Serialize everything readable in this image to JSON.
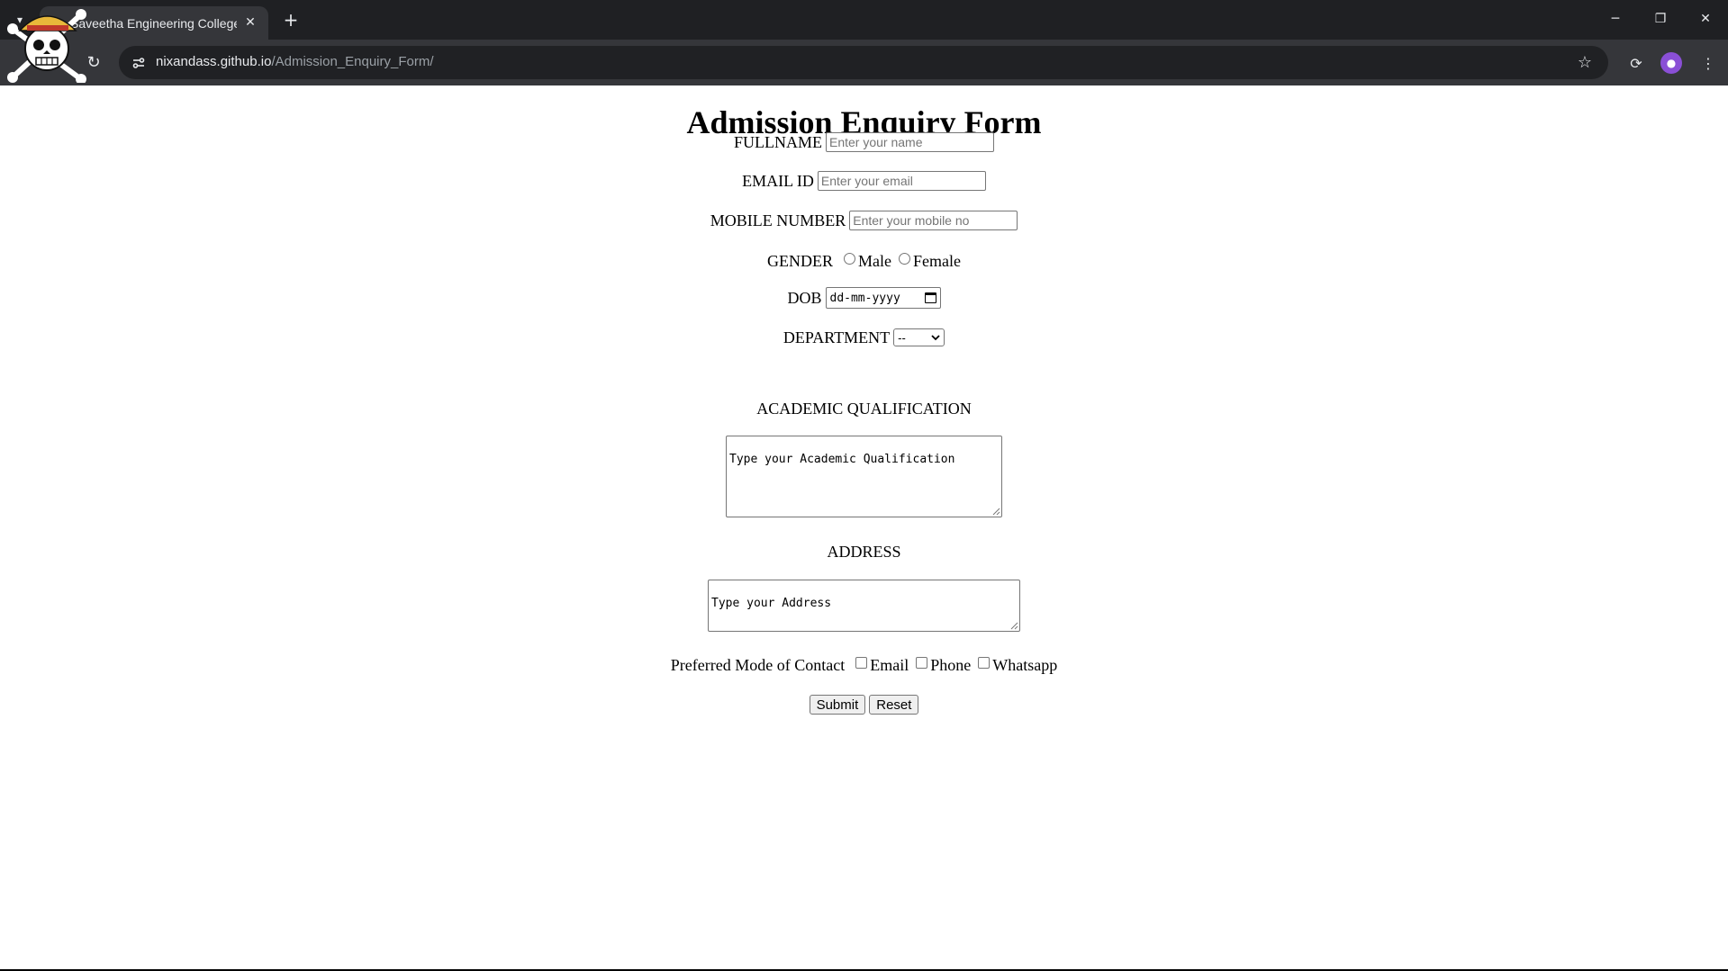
{
  "browser": {
    "tab_title": "Saveetha Engineering College -",
    "tab_close": "✕",
    "new_tab": "+",
    "url_host": "nixandass.github.io",
    "url_path": "/Admission_Enquiry_Form/",
    "icons": [
      "tab-list-icon",
      "reload-icon",
      "site-info-icon",
      "bookmark-star-icon",
      "extensions-icon",
      "profile-icon",
      "menu-icon",
      "pirate-logo-icon"
    ]
  },
  "form": {
    "title": "Admission Enquiry Form",
    "fullname_label": "FULLNAME",
    "fullname_placeholder": "Enter your name",
    "email_label": "EMAIL ID",
    "email_placeholder": "Enter your email",
    "mobile_label": "MOBILE NUMBER",
    "mobile_placeholder": "Enter your mobile no",
    "gender_label": "GENDER",
    "gender_options": [
      "Male",
      "Female"
    ],
    "dob_label": "DOB",
    "dob_value": "dd-mm-yyyy",
    "department_label": "DEPARTMENT",
    "department_selected": "--",
    "academic_label": "ACADEMIC QUALIFICATION",
    "academic_value": "Type your Academic Qualification",
    "address_label": "ADDRESS",
    "address_value": "Type your Address",
    "contact_label": "Preferred Mode of Contact",
    "contact_options": [
      "Email",
      "Phone",
      "Whatsapp"
    ],
    "submit_label": "Submit",
    "reset_label": "Reset"
  }
}
